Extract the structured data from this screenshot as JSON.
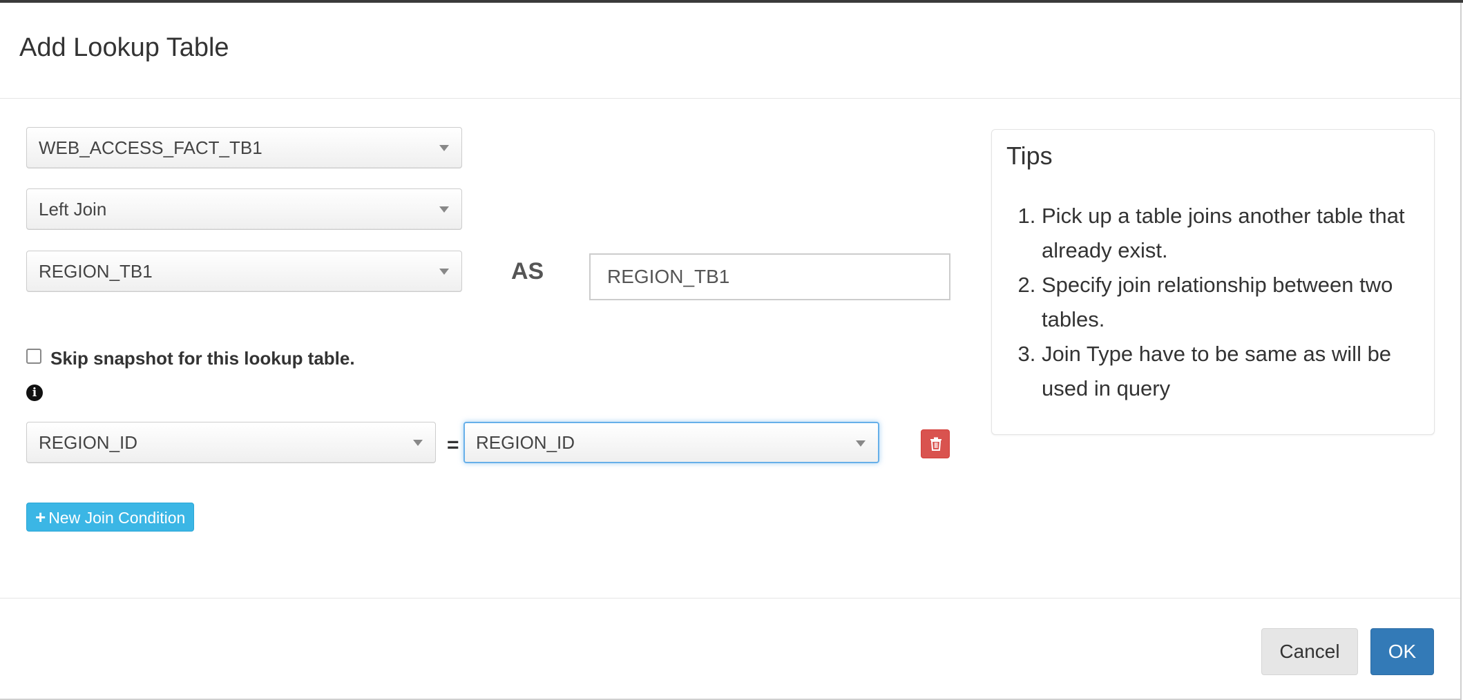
{
  "dialog": {
    "title": "Add Lookup Table"
  },
  "form": {
    "fact_table": {
      "selected": "WEB_ACCESS_FACT_TB1"
    },
    "join_type": {
      "selected": "Left Join"
    },
    "lookup_table": {
      "selected": "REGION_TB1"
    },
    "as_label": "AS",
    "alias_input": {
      "value": "REGION_TB1"
    },
    "skip_snapshot": {
      "label": "Skip snapshot for this lookup table.",
      "checked": false
    },
    "join_conditions": [
      {
        "left": "REGION_ID",
        "operator": "=",
        "right": "REGION_ID"
      }
    ],
    "new_join_condition_label": "New Join Condition"
  },
  "tips": {
    "title": "Tips",
    "items": [
      "Pick up a table joins another table that already exist.",
      "Specify join relationship between two tables.",
      "Join Type have to be same as will be used in query"
    ]
  },
  "footer": {
    "cancel_label": "Cancel",
    "ok_label": "OK"
  },
  "colors": {
    "primary": "#337ab7",
    "info": "#3bb6e5",
    "danger": "#d9534f",
    "focus": "#66afe9"
  },
  "icons": {
    "info": "info-circle-icon",
    "delete": "trash-icon",
    "add": "plus-icon",
    "select": "caret-down-icon"
  }
}
